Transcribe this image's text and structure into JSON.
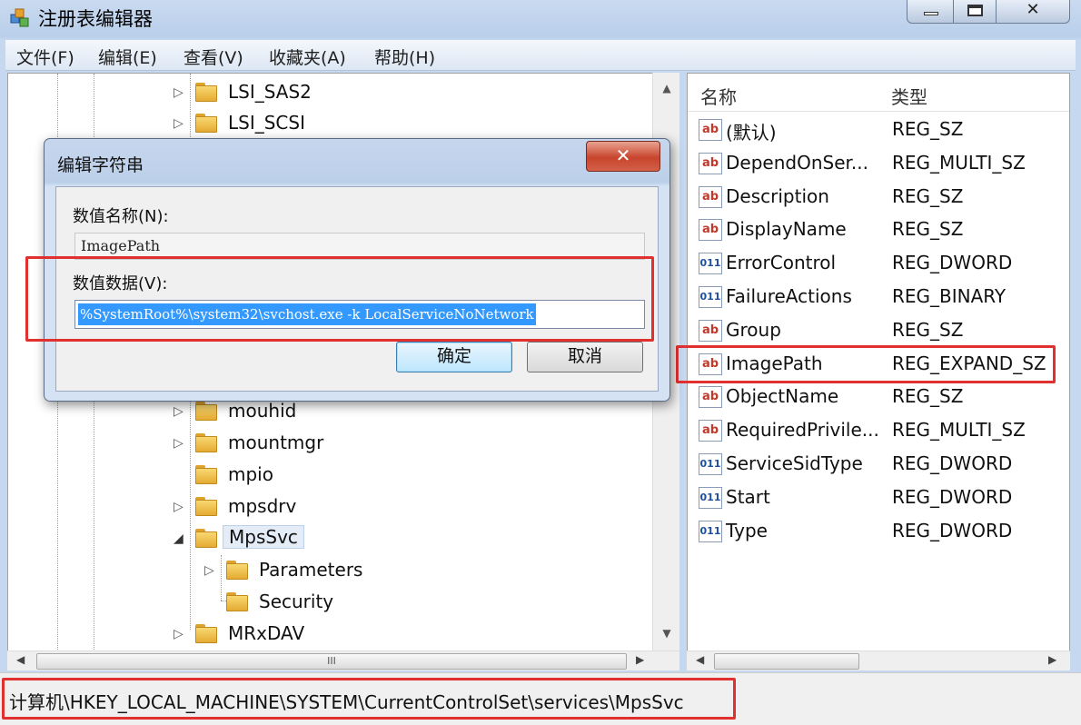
{
  "window": {
    "title": "注册表编辑器",
    "minimize_glyph": "–",
    "close_glyph": "✕"
  },
  "menu": {
    "items": [
      "文件(F)",
      "编辑(E)",
      "查看(V)",
      "收藏夹(A)",
      "帮助(H)"
    ]
  },
  "tree": {
    "items": [
      {
        "label": "LSI_SAS2",
        "has_children": true
      },
      {
        "label": "LSI_SCSI",
        "has_children": true
      },
      {
        "label": "mouhid",
        "has_children": true
      },
      {
        "label": "mountmgr",
        "has_children": true
      },
      {
        "label": "mpio",
        "has_children": false
      },
      {
        "label": "mpsdrv",
        "has_children": true
      },
      {
        "label": "MpsSvc",
        "has_children": true,
        "expanded": true,
        "selected": true
      },
      {
        "label": "Parameters",
        "has_children": true,
        "child": true
      },
      {
        "label": "Security",
        "has_children": false,
        "child": true
      },
      {
        "label": "MRxDAV",
        "has_children": true
      }
    ],
    "expand_glyph": "▷",
    "expanded_glyph": "◢",
    "scroll_up": "▲",
    "scroll_down": "▼",
    "hscroll_thumb": "III",
    "hscroll_left": "◀",
    "hscroll_right": "▶"
  },
  "list": {
    "col_name": "名称",
    "col_type": "类型",
    "rows": [
      {
        "name": "(默认)",
        "type": "REG_SZ",
        "icon": "ab"
      },
      {
        "name": "DependOnSer...",
        "type": "REG_MULTI_SZ",
        "icon": "ab"
      },
      {
        "name": "Description",
        "type": "REG_SZ",
        "icon": "ab"
      },
      {
        "name": "DisplayName",
        "type": "REG_SZ",
        "icon": "ab"
      },
      {
        "name": "ErrorControl",
        "type": "REG_DWORD",
        "icon": "num"
      },
      {
        "name": "FailureActions",
        "type": "REG_BINARY",
        "icon": "num"
      },
      {
        "name": "Group",
        "type": "REG_SZ",
        "icon": "ab"
      },
      {
        "name": "ImagePath",
        "type": "REG_EXPAND_SZ",
        "icon": "ab",
        "highlighted": true
      },
      {
        "name": "ObjectName",
        "type": "REG_SZ",
        "icon": "ab"
      },
      {
        "name": "RequiredPrivile...",
        "type": "REG_MULTI_SZ",
        "icon": "ab"
      },
      {
        "name": "ServiceSidType",
        "type": "REG_DWORD",
        "icon": "num"
      },
      {
        "name": "Start",
        "type": "REG_DWORD",
        "icon": "num"
      },
      {
        "name": "Type",
        "type": "REG_DWORD",
        "icon": "num"
      }
    ]
  },
  "dialog": {
    "title": "编辑字符串",
    "close_glyph": "✕",
    "name_label": "数值名称(N):",
    "name_value": "ImagePath",
    "data_label": "数值数据(V):",
    "data_value": "%SystemRoot%\\system32\\svchost.exe -k LocalServiceNoNetwork",
    "ok_label": "确定",
    "cancel_label": "取消"
  },
  "status": {
    "path": "计算机\\HKEY_LOCAL_MACHINE\\SYSTEM\\CurrentControlSet\\services\\MpsSvc"
  },
  "colors": {
    "highlight": "#e03030",
    "selection": "#3399ff"
  }
}
